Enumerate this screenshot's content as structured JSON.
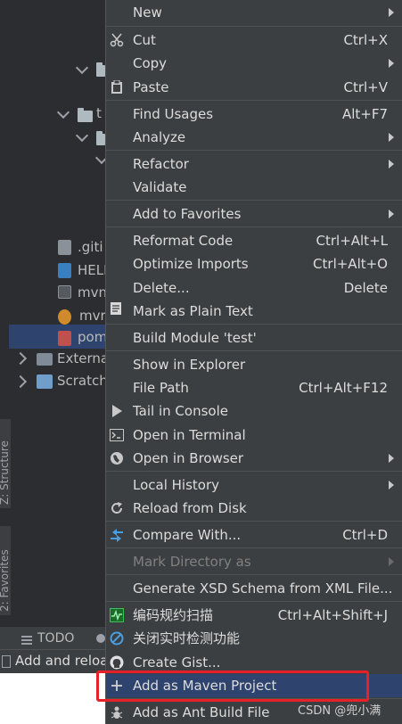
{
  "project_tree": {
    "items": [
      {
        "label": ".giti",
        "type": "gitignore"
      },
      {
        "label": "HELI",
        "type": "markdown"
      },
      {
        "label": "mvn",
        "type": "script"
      },
      {
        "label": "mvr",
        "type": "settings"
      },
      {
        "label": "pom",
        "type": "xml"
      },
      {
        "label": "Externa",
        "type": "library"
      },
      {
        "label": "Scratch",
        "type": "scratch"
      }
    ],
    "folder_stub": "t"
  },
  "side_tabs": {
    "structure": "Z: Structure",
    "favorites": "2: Favorites"
  },
  "bottom_bar": {
    "todo_label": "TODO"
  },
  "status_bar": {
    "text": "Add and reloa"
  },
  "context_menu": {
    "items": [
      {
        "label": "New",
        "shortcut": "",
        "submenu": true,
        "icon": ""
      },
      {
        "label": "Cut",
        "shortcut": "Ctrl+X",
        "icon": "scissors-icon"
      },
      {
        "label": "Copy",
        "shortcut": "",
        "submenu": true,
        "icon": ""
      },
      {
        "label": "Paste",
        "shortcut": "Ctrl+V",
        "icon": "clipboard-icon"
      },
      {
        "label": "Find Usages",
        "shortcut": "Alt+F7",
        "icon": ""
      },
      {
        "label": "Analyze",
        "shortcut": "",
        "submenu": true,
        "icon": ""
      },
      {
        "label": "Refactor",
        "shortcut": "",
        "submenu": true,
        "icon": ""
      },
      {
        "label": "Validate",
        "shortcut": "",
        "icon": ""
      },
      {
        "label": "Add to Favorites",
        "shortcut": "",
        "submenu": true,
        "icon": ""
      },
      {
        "label": "Reformat Code",
        "shortcut": "Ctrl+Alt+L",
        "icon": ""
      },
      {
        "label": "Optimize Imports",
        "shortcut": "Ctrl+Alt+O",
        "icon": ""
      },
      {
        "label": "Delete...",
        "shortcut": "Delete",
        "icon": ""
      },
      {
        "label": "Mark as Plain Text",
        "shortcut": "",
        "icon": "plain-text-icon"
      },
      {
        "label": "Build Module 'test'",
        "shortcut": "",
        "icon": ""
      },
      {
        "label": "Show in Explorer",
        "shortcut": "",
        "icon": ""
      },
      {
        "label": "File Path",
        "shortcut": "Ctrl+Alt+F12",
        "icon": ""
      },
      {
        "label": "Tail in Console",
        "shortcut": "",
        "icon": "play-icon"
      },
      {
        "label": "Open in Terminal",
        "shortcut": "",
        "icon": "terminal-icon"
      },
      {
        "label": "Open in Browser",
        "shortcut": "",
        "submenu": true,
        "icon": "globe-icon"
      },
      {
        "label": "Local History",
        "shortcut": "",
        "submenu": true,
        "icon": ""
      },
      {
        "label": "Reload from Disk",
        "shortcut": "",
        "icon": "reload-icon"
      },
      {
        "label": "Compare With...",
        "shortcut": "Ctrl+D",
        "icon": "compare-icon"
      },
      {
        "label": "Mark Directory as",
        "shortcut": "",
        "submenu": true,
        "disabled": true,
        "icon": ""
      },
      {
        "label": "Generate XSD Schema from XML File...",
        "shortcut": "",
        "icon": ""
      },
      {
        "label": "编码规约扫描",
        "shortcut": "Ctrl+Alt+Shift+J",
        "icon": "scan-icon"
      },
      {
        "label": "关闭实时检测功能",
        "shortcut": "",
        "icon": "disable-icon"
      },
      {
        "label": "Create Gist...",
        "shortcut": "",
        "icon": "github-icon"
      },
      {
        "label": "Add as Maven Project",
        "shortcut": "",
        "icon": "plus-icon",
        "active": true
      },
      {
        "label": "Add as Ant Build File",
        "shortcut": "",
        "icon": "ant-icon"
      }
    ]
  },
  "watermark": "CSDN @兜小满",
  "colors": {
    "menu_bg": "#3c3f41",
    "highlight": "#2e436e",
    "annotation_red": "#e8202a"
  }
}
